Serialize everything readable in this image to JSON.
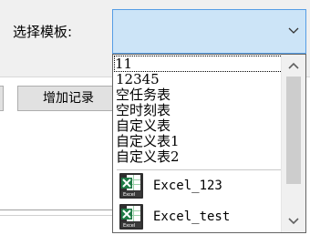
{
  "form": {
    "select_label": "选择模板:",
    "add_button": "增加记录"
  },
  "dropdown": {
    "items": [
      {
        "label": "11",
        "focused": true
      },
      {
        "label": "12345"
      },
      {
        "label": "空任务表"
      },
      {
        "label": "空时刻表"
      },
      {
        "label": "自定义表"
      },
      {
        "label": "自定义表1"
      },
      {
        "label": "自定义表2"
      }
    ],
    "files": [
      {
        "name": "Excel_123",
        "icon": "excel-file-icon"
      },
      {
        "name": "Excel_test",
        "icon": "excel-file-icon"
      }
    ]
  },
  "colors": {
    "combo_fill": "#cce4f7",
    "combo_border": "#569de5",
    "excel_green": "#1e7b45"
  },
  "icons": {
    "combo_toggle": "chevron-down-icon",
    "scroll_up": "scroll-up-arrow-icon",
    "scroll_down": "scroll-down-arrow-icon"
  }
}
